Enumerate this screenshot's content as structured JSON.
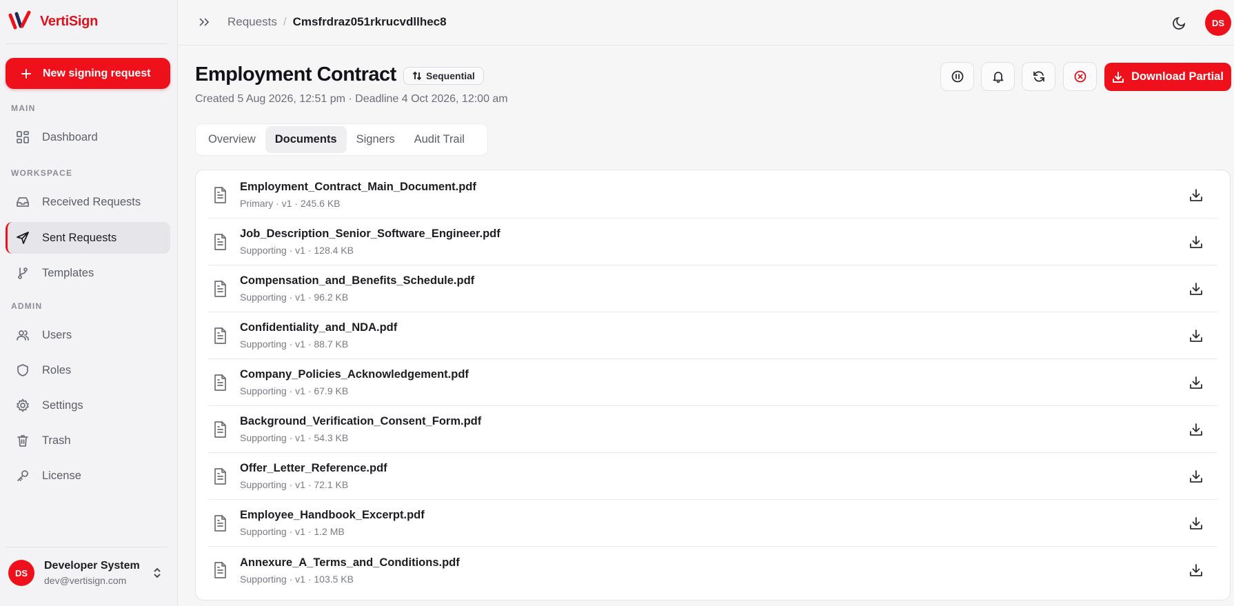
{
  "brand": {
    "name": "VertiSign",
    "color": "#e0111c"
  },
  "sidebar": {
    "new_request_label": "New signing request",
    "sections": {
      "main": "MAIN",
      "workspace": "WORKSPACE",
      "admin": "ADMIN"
    },
    "items": [
      {
        "label": "Dashboard",
        "icon": "dashboard-icon"
      },
      {
        "label": "Received Requests",
        "icon": "inbox-icon"
      },
      {
        "label": "Sent Requests",
        "icon": "send-icon",
        "active": true
      },
      {
        "label": "Templates",
        "icon": "branch-icon"
      },
      {
        "label": "Users",
        "icon": "users-icon"
      },
      {
        "label": "Roles",
        "icon": "shield-icon"
      },
      {
        "label": "Settings",
        "icon": "gear-icon"
      },
      {
        "label": "Trash",
        "icon": "trash-icon"
      },
      {
        "label": "License",
        "icon": "key-icon"
      }
    ],
    "user": {
      "initials": "DS",
      "name": "Developer System",
      "email": "dev@vertisign.com"
    }
  },
  "topbar": {
    "breadcrumb_parent": "Requests",
    "breadcrumb_sep": "/",
    "breadcrumb_current": "Cmsfrdraz051rkrucvdllhec8",
    "avatar_initials": "DS"
  },
  "request": {
    "title": "Employment Contract",
    "mode_label": "Sequential",
    "created_line": "Created 5 Aug 2026, 12:51 pm · Deadline 4 Oct 2026, 12:00 am",
    "download_label": "Download Partial"
  },
  "tabs": [
    "Overview",
    "Documents",
    "Signers",
    "Audit Trail"
  ],
  "active_tab": "Documents",
  "documents": [
    {
      "name": "Employment_Contract_Main_Document.pdf",
      "meta": "Primary · v1 · 245.6 KB"
    },
    {
      "name": "Job_Description_Senior_Software_Engineer.pdf",
      "meta": "Supporting · v1 · 128.4 KB"
    },
    {
      "name": "Compensation_and_Benefits_Schedule.pdf",
      "meta": "Supporting · v1 · 96.2 KB"
    },
    {
      "name": "Confidentiality_and_NDA.pdf",
      "meta": "Supporting · v1 · 88.7 KB"
    },
    {
      "name": "Company_Policies_Acknowledgement.pdf",
      "meta": "Supporting · v1 · 67.9 KB"
    },
    {
      "name": "Background_Verification_Consent_Form.pdf",
      "meta": "Supporting · v1 · 54.3 KB"
    },
    {
      "name": "Offer_Letter_Reference.pdf",
      "meta": "Supporting · v1 · 72.1 KB"
    },
    {
      "name": "Employee_Handbook_Excerpt.pdf",
      "meta": "Supporting · v1 · 1.2 MB"
    },
    {
      "name": "Annexure_A_Terms_and_Conditions.pdf",
      "meta": "Supporting · v1 · 103.5 KB"
    }
  ]
}
